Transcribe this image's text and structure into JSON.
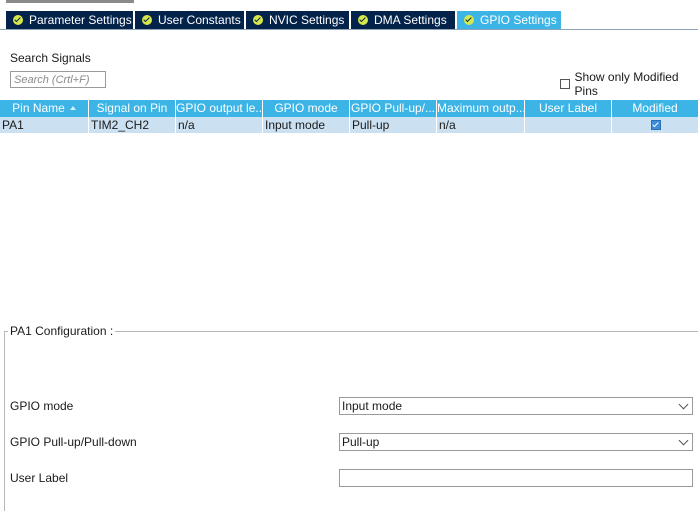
{
  "tabs": [
    {
      "label": "Parameter Settings",
      "icon": "check-circle-icon",
      "active": false
    },
    {
      "label": "User Constants",
      "icon": "check-circle-icon",
      "active": false
    },
    {
      "label": "NVIC Settings",
      "icon": "check-circle-icon",
      "active": false
    },
    {
      "label": "DMA Settings",
      "icon": "check-circle-icon",
      "active": false
    },
    {
      "label": "GPIO Settings",
      "icon": "check-circle-icon",
      "active": true
    }
  ],
  "search": {
    "label": "Search Signals",
    "placeholder": "Search (Crtl+F)",
    "value": ""
  },
  "filter": {
    "show_modified_label": "Show only Modified Pins",
    "checked": false
  },
  "table": {
    "columns": [
      "Pin Name",
      "Signal on Pin",
      "GPIO output le...",
      "GPIO mode",
      "GPIO Pull-up/...",
      "Maximum outp...",
      "User Label",
      "Modified"
    ],
    "sort_column": "Pin Name",
    "rows": [
      {
        "pin": "PA1",
        "signal": "TIM2_CH2",
        "output_level": "n/a",
        "mode": "Input mode",
        "pull": "Pull-up",
        "max_speed": "n/a",
        "user_label": "",
        "modified": true
      }
    ]
  },
  "config": {
    "title": "PA1 Configuration :",
    "gpio_mode_label": "GPIO mode",
    "gpio_mode_value": "Input mode",
    "pull_label": "GPIO Pull-up/Pull-down",
    "pull_value": "Pull-up",
    "user_label_label": "User Label",
    "user_label_value": ""
  },
  "colors": {
    "tab_bg": "#03234b",
    "tab_active_bg": "#3cb4e6",
    "header_bg": "#3cb4e6",
    "row_selected_bg": "#cbe0f1",
    "check_icon": "#d7e84a"
  }
}
